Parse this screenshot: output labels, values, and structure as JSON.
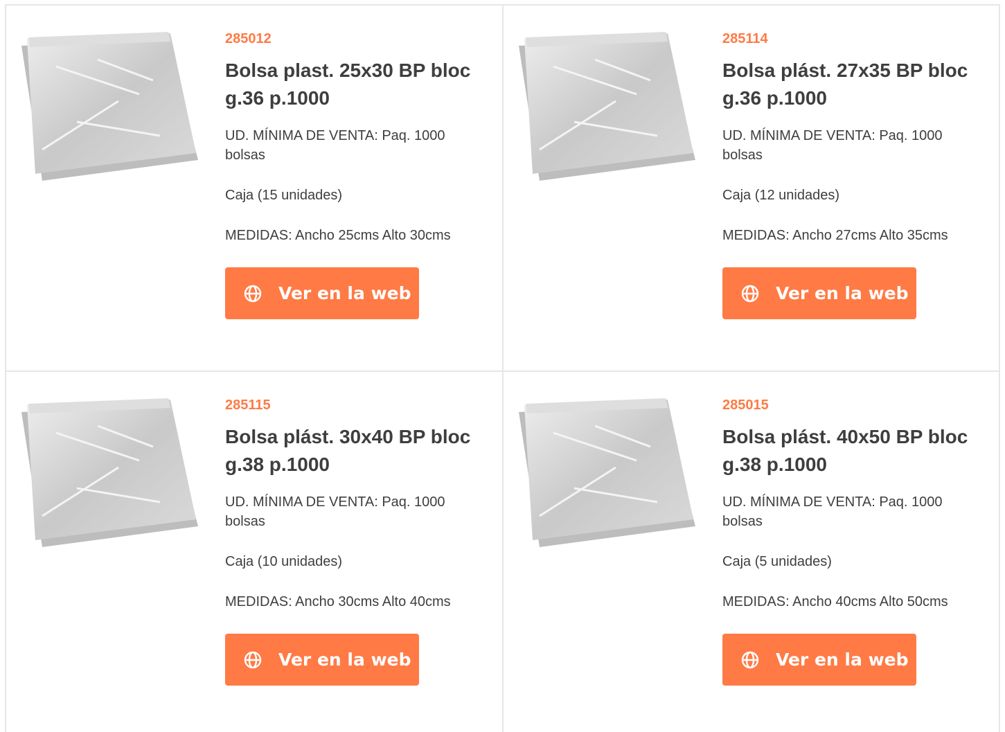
{
  "products": [
    {
      "code": "285012",
      "title": "Bolsa plast. 25x30 BP bloc g.36 p.1000",
      "min_sale": "UD. MÍNIMA DE VENTA:  Paq. 1000 bolsas",
      "box": "Caja (15 unidades)",
      "measures": "MEDIDAS:  Ancho 25cms  Alto 30cms",
      "button_label": "Ver en la web",
      "button_icon": "globe-icon",
      "image_alt": "Bolsa plástica transparente"
    },
    {
      "code": "285114",
      "title": "Bolsa plást. 27x35 BP bloc g.36 p.1000",
      "min_sale": "UD. MÍNIMA DE VENTA:  Paq. 1000 bolsas",
      "box": "Caja (12 unidades)",
      "measures": "MEDIDAS:  Ancho 27cms  Alto 35cms",
      "button_label": "Ver en la web",
      "button_icon": "globe-icon",
      "image_alt": "Bolsa plástica transparente"
    },
    {
      "code": "285115",
      "title": "Bolsa plást. 30x40 BP bloc g.38 p.1000",
      "min_sale": "UD. MÍNIMA DE VENTA:  Paq. 1000 bolsas",
      "box": "Caja (10 unidades)",
      "measures": "MEDIDAS:  Ancho 30cms  Alto 40cms",
      "button_label": "Ver en la web",
      "button_icon": "globe-icon",
      "image_alt": "Bolsa plástica transparente"
    },
    {
      "code": "285015",
      "title": "Bolsa plást. 40x50 BP bloc g.38 p.1000",
      "min_sale": "UD. MÍNIMA DE VENTA:  Paq. 1000 bolsas",
      "box": "Caja (5 unidades)",
      "measures": "MEDIDAS: Ancho 40cms  Alto 50cms",
      "button_label": "Ver en la web",
      "button_icon": "globe-icon",
      "image_alt": "Bolsa plástica transparente"
    }
  ],
  "colors": {
    "accent": "#ff7a45",
    "text": "#3e3e3e",
    "border": "#e6e6e6",
    "button_text": "#ffffff"
  }
}
